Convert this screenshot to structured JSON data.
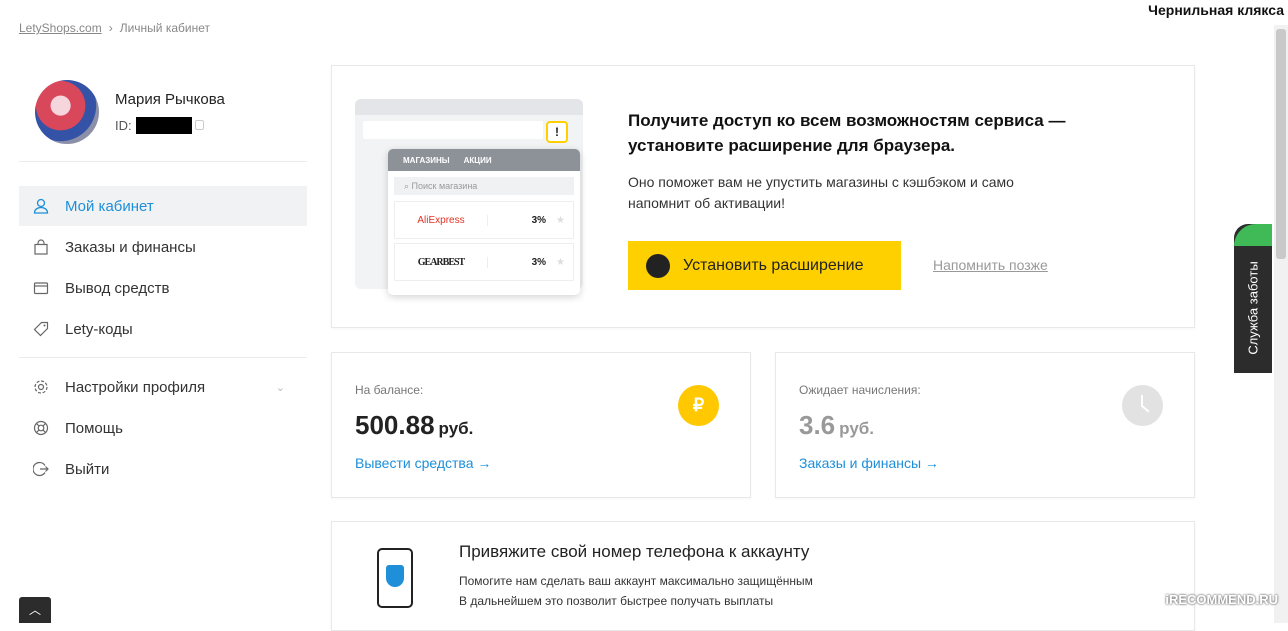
{
  "top_user": "Чернильная клякса",
  "breadcrumb": {
    "home": "LetyShops.com",
    "current": "Личный кабинет"
  },
  "profile": {
    "name": "Мария Рычкова",
    "id_label": "ID:"
  },
  "nav": {
    "cabinet": "Мой кабинет",
    "orders": "Заказы и финансы",
    "withdraw": "Вывод средств",
    "codes": "Lety-коды",
    "settings": "Настройки профиля",
    "help": "Помощь",
    "logout": "Выйти"
  },
  "promo": {
    "title": "Получите доступ ко всем возможностям сервиса — установите расширение для браузера.",
    "text": "Оно поможет вам не упустить магазины с кэшбэком и само напомнит об активации!",
    "install_button": "Установить расширение",
    "later_link": "Напомнить позже",
    "illustration": {
      "tab_shops": "МАГАЗИНЫ",
      "tab_promos": "АКЦИИ",
      "search_placeholder": "Поиск магазина",
      "shops": [
        {
          "name": "AliExpress",
          "rate": "3%"
        },
        {
          "name": "GEARBEST",
          "rate": "3%"
        }
      ]
    }
  },
  "balance": {
    "label": "На балансе:",
    "amount": "500.88",
    "currency": "руб.",
    "link": "Вывести средства →",
    "icon_symbol": "₽"
  },
  "pending": {
    "label": "Ожидает начисления:",
    "amount": "3.6",
    "currency": "руб.",
    "link": "Заказы и финансы →"
  },
  "phone": {
    "title": "Привяжите свой номер телефона к аккаунту",
    "line1": "Помогите нам сделать ваш аккаунт максимально защищённым",
    "line2": "В дальнейшем это позволит быстрее получать выплаты"
  },
  "service_tab": "Служба заботы",
  "watermark": "iRECOMMEND.RU",
  "colors": {
    "accent_blue": "#1e8fd8",
    "accent_yellow": "#ffd000",
    "green": "#3fba57"
  }
}
